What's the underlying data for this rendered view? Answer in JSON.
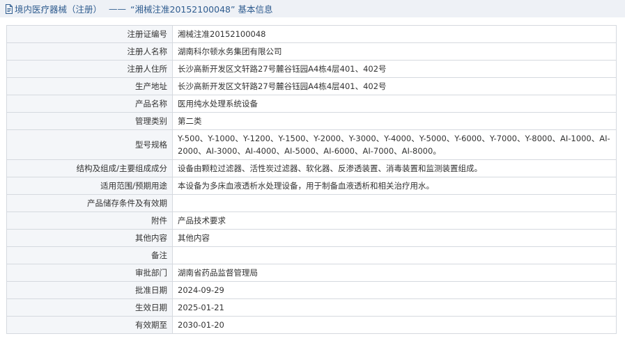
{
  "header": {
    "icon": "document-icon",
    "title_main": "境内医疗器械（注册）",
    "title_sep": "——",
    "title_quote": "“湘械注准20152100048”",
    "title_suffix": "基本信息",
    "color": "#2f5c8f",
    "background": "#eef1f6"
  },
  "rows": [
    {
      "label": "注册证编号",
      "value": "湘械注准20152100048"
    },
    {
      "label": "注册人名称",
      "value": "湖南科尔顿水务集团有限公司"
    },
    {
      "label": "注册人住所",
      "value": "长沙高新开发区文轩路27号麓谷钰园A4栋4层401、402号"
    },
    {
      "label": "生产地址",
      "value": "长沙高新开发区文轩路27号麓谷钰园A4栋4层401、402号"
    },
    {
      "label": "产品名称",
      "value": "医用纯水处理系统设备"
    },
    {
      "label": "管理类别",
      "value": "第二类"
    },
    {
      "label": "型号规格",
      "value": "Y-500、Y-1000、Y-1200、Y-1500、Y-2000、Y-3000、Y-4000、Y-5000、Y-6000、Y-7000、Y-8000、AI-1000、AI-2000、AI-3000、AI-4000、AI-5000、AI-6000、AI-7000、AI-8000。"
    },
    {
      "label": "结构及组成/主要组成成分",
      "value": "设备由颗粒过滤器、活性炭过滤器、软化器、反渗透装置、消毒装置和监测装置组成。"
    },
    {
      "label": "适用范围/预期用途",
      "value": "本设备为多床血液透析水处理设备，用于制备血液透析和相关治疗用水。"
    },
    {
      "label": "产品储存条件及有效期",
      "value": ""
    },
    {
      "label": "附件",
      "value": "产品技术要求"
    },
    {
      "label": "其他内容",
      "value": "其他内容"
    },
    {
      "label": "备注",
      "value": ""
    },
    {
      "label": "审批部门",
      "value": "湖南省药品监督管理局"
    },
    {
      "label": "批准日期",
      "value": "2024-09-29"
    },
    {
      "label": "生效日期",
      "value": "2025-01-21"
    },
    {
      "label": "有效期至",
      "value": "2030-01-20"
    }
  ]
}
